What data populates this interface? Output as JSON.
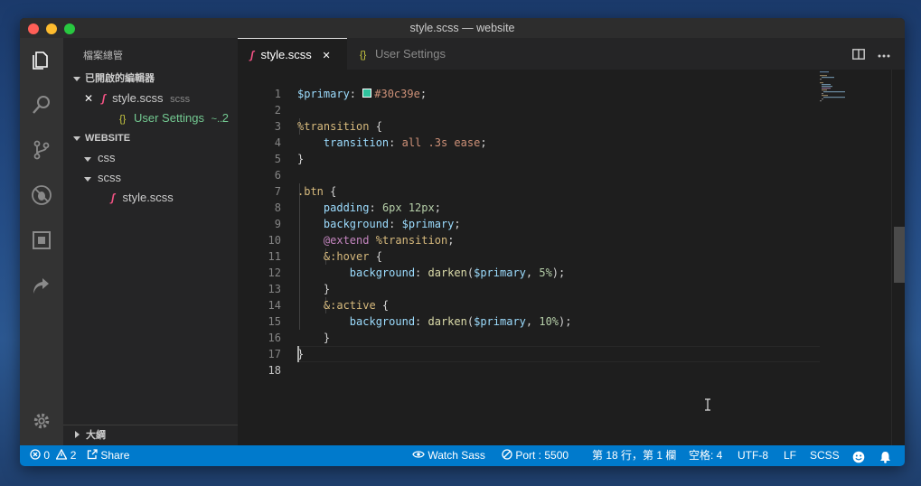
{
  "window": {
    "title": "style.scss — website"
  },
  "activity_bar": {
    "icons": [
      "files-icon",
      "search-icon",
      "source-control-icon",
      "debug-icon",
      "extensions-icon",
      "remote-icon"
    ],
    "bottom_icon": "gear-icon"
  },
  "sidebar": {
    "title": "檔案總管",
    "open_editors": {
      "header": "已開啟的編輯器",
      "items": [
        {
          "name": "style.scss",
          "desc": "scss",
          "close": "✕"
        },
        {
          "name": "User Settings",
          "desc": "~...",
          "badge": "2",
          "icon": "{}"
        }
      ]
    },
    "workspace": {
      "header": "WEBSITE",
      "folders": [
        {
          "name": "css"
        },
        {
          "name": "scss",
          "children": [
            {
              "name": "style.scss"
            }
          ]
        }
      ]
    },
    "outline": {
      "header": "大綱"
    }
  },
  "tabs": [
    {
      "label": "style.scss",
      "close": "✕",
      "active": true
    },
    {
      "label": "User Settings",
      "icon": "{}",
      "active": false
    }
  ],
  "editor": {
    "current_line": 18,
    "color_swatch": "#30c39e",
    "lines": [
      {
        "n": "1",
        "segments": [
          {
            "t": "$primary",
            "c": "var"
          },
          {
            "t": ": ",
            "c": "punc"
          },
          {
            "t": "SWATCH",
            "c": "swatch"
          },
          {
            "t": "#30c39e",
            "c": "val"
          },
          {
            "t": ";",
            "c": "punc"
          }
        ]
      },
      {
        "n": "2",
        "segments": []
      },
      {
        "n": "3",
        "segments": [
          {
            "t": "%transition",
            "c": "sel"
          },
          {
            "t": " {",
            "c": "punc"
          }
        ]
      },
      {
        "n": "4",
        "segments": [
          {
            "t": "    ",
            "c": "punc"
          },
          {
            "t": "transition",
            "c": "prop"
          },
          {
            "t": ": ",
            "c": "punc"
          },
          {
            "t": "all .3s ease",
            "c": "val"
          },
          {
            "t": ";",
            "c": "punc"
          }
        ]
      },
      {
        "n": "5",
        "segments": [
          {
            "t": "}",
            "c": "punc"
          }
        ]
      },
      {
        "n": "6",
        "segments": []
      },
      {
        "n": "7",
        "segments": [
          {
            "t": ".btn",
            "c": "sel"
          },
          {
            "t": " {",
            "c": "punc"
          }
        ]
      },
      {
        "n": "8",
        "segments": [
          {
            "t": "    ",
            "c": "punc"
          },
          {
            "t": "padding",
            "c": "prop"
          },
          {
            "t": ": ",
            "c": "punc"
          },
          {
            "t": "6px 12px",
            "c": "num"
          },
          {
            "t": ";",
            "c": "punc"
          }
        ]
      },
      {
        "n": "9",
        "segments": [
          {
            "t": "    ",
            "c": "punc"
          },
          {
            "t": "background",
            "c": "prop"
          },
          {
            "t": ": ",
            "c": "punc"
          },
          {
            "t": "$primary",
            "c": "var"
          },
          {
            "t": ";",
            "c": "punc"
          }
        ]
      },
      {
        "n": "10",
        "segments": [
          {
            "t": "    ",
            "c": "punc"
          },
          {
            "t": "@extend",
            "c": "kw"
          },
          {
            "t": " ",
            "c": "punc"
          },
          {
            "t": "%transition",
            "c": "sel"
          },
          {
            "t": ";",
            "c": "punc"
          }
        ]
      },
      {
        "n": "11",
        "segments": [
          {
            "t": "    ",
            "c": "punc"
          },
          {
            "t": "&:hover",
            "c": "sel"
          },
          {
            "t": " {",
            "c": "punc"
          }
        ]
      },
      {
        "n": "12",
        "segments": [
          {
            "t": "        ",
            "c": "punc"
          },
          {
            "t": "background",
            "c": "prop"
          },
          {
            "t": ": ",
            "c": "punc"
          },
          {
            "t": "darken",
            "c": "fn"
          },
          {
            "t": "(",
            "c": "punc"
          },
          {
            "t": "$primary",
            "c": "var"
          },
          {
            "t": ", ",
            "c": "punc"
          },
          {
            "t": "5%",
            "c": "num"
          },
          {
            "t": ");",
            "c": "punc"
          }
        ]
      },
      {
        "n": "13",
        "segments": [
          {
            "t": "    }",
            "c": "punc"
          }
        ]
      },
      {
        "n": "14",
        "segments": [
          {
            "t": "    ",
            "c": "punc"
          },
          {
            "t": "&:active",
            "c": "sel"
          },
          {
            "t": " {",
            "c": "punc"
          }
        ]
      },
      {
        "n": "15",
        "segments": [
          {
            "t": "        ",
            "c": "punc"
          },
          {
            "t": "background",
            "c": "prop"
          },
          {
            "t": ": ",
            "c": "punc"
          },
          {
            "t": "darken",
            "c": "fn"
          },
          {
            "t": "(",
            "c": "punc"
          },
          {
            "t": "$primary",
            "c": "var"
          },
          {
            "t": ", ",
            "c": "punc"
          },
          {
            "t": "10%",
            "c": "num"
          },
          {
            "t": ");",
            "c": "punc"
          }
        ]
      },
      {
        "n": "16",
        "segments": [
          {
            "t": "    }",
            "c": "punc"
          }
        ]
      },
      {
        "n": "17",
        "segments": [
          {
            "t": "}",
            "c": "punc"
          }
        ]
      },
      {
        "n": "18",
        "segments": []
      }
    ]
  },
  "status_bar": {
    "errors": "0",
    "warnings": "2",
    "share": "Share",
    "watch_sass": "Watch Sass",
    "port": "Port : 5500",
    "position": "第 18 行，第 1 欄",
    "spaces": "空格: 4",
    "encoding": "UTF-8",
    "eol": "LF",
    "language": "SCSS"
  },
  "colors": {
    "status_bar": "#007acc",
    "activity_bar": "#333333",
    "sidebar": "#252526",
    "editor": "#1e1e1e",
    "sass_icon": "#f55385"
  }
}
